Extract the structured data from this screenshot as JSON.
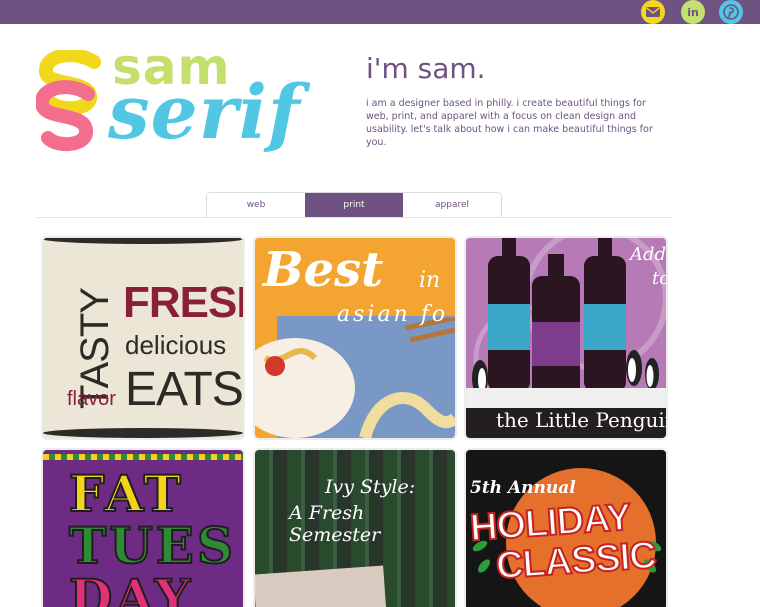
{
  "header": {
    "social": [
      {
        "icon": "mail-icon",
        "color": "#f2d81c"
      },
      {
        "icon": "linkedin-icon",
        "label": "in",
        "color": "#c5df6d"
      },
      {
        "icon": "pinterest-icon",
        "color": "#52c7e3"
      }
    ],
    "bar_color": "#6e5382"
  },
  "logo": {
    "line1": "sam",
    "line2": "serif",
    "colors": [
      "#c5df6d",
      "#52c7e3",
      "#f2d81c",
      "#f36e8c"
    ]
  },
  "intro": {
    "title": "i'm sam.",
    "text": "i am a designer based in philly. i create beautiful things for web, print, and apparel with a focus on clean design and usability. let's talk about how i can make beautiful things for you."
  },
  "tabs": [
    {
      "label": "web",
      "active": false
    },
    {
      "label": "print",
      "active": true
    },
    {
      "label": "apparel",
      "active": false
    }
  ],
  "portfolio": {
    "fresh": {
      "tasty": "TASTY",
      "fresh": "FRESH",
      "delicious": "delicious",
      "flavor": "flavor",
      "eats": "EATS"
    },
    "best": {
      "best": "Best",
      "in": "in",
      "asian": "asian fo"
    },
    "penguin": {
      "add": "Add",
      "to": "to",
      "name": "the Little Penguin"
    },
    "fat": {
      "line1": "FAT",
      "line2": "TUES",
      "line3": "DAY"
    },
    "ivy": {
      "line1": "Ivy Style:",
      "line2": "A Fresh Semester"
    },
    "holiday": {
      "annual": "5th Annual",
      "holiday": "HOLIDAY",
      "classic": "CLASSIC"
    }
  }
}
